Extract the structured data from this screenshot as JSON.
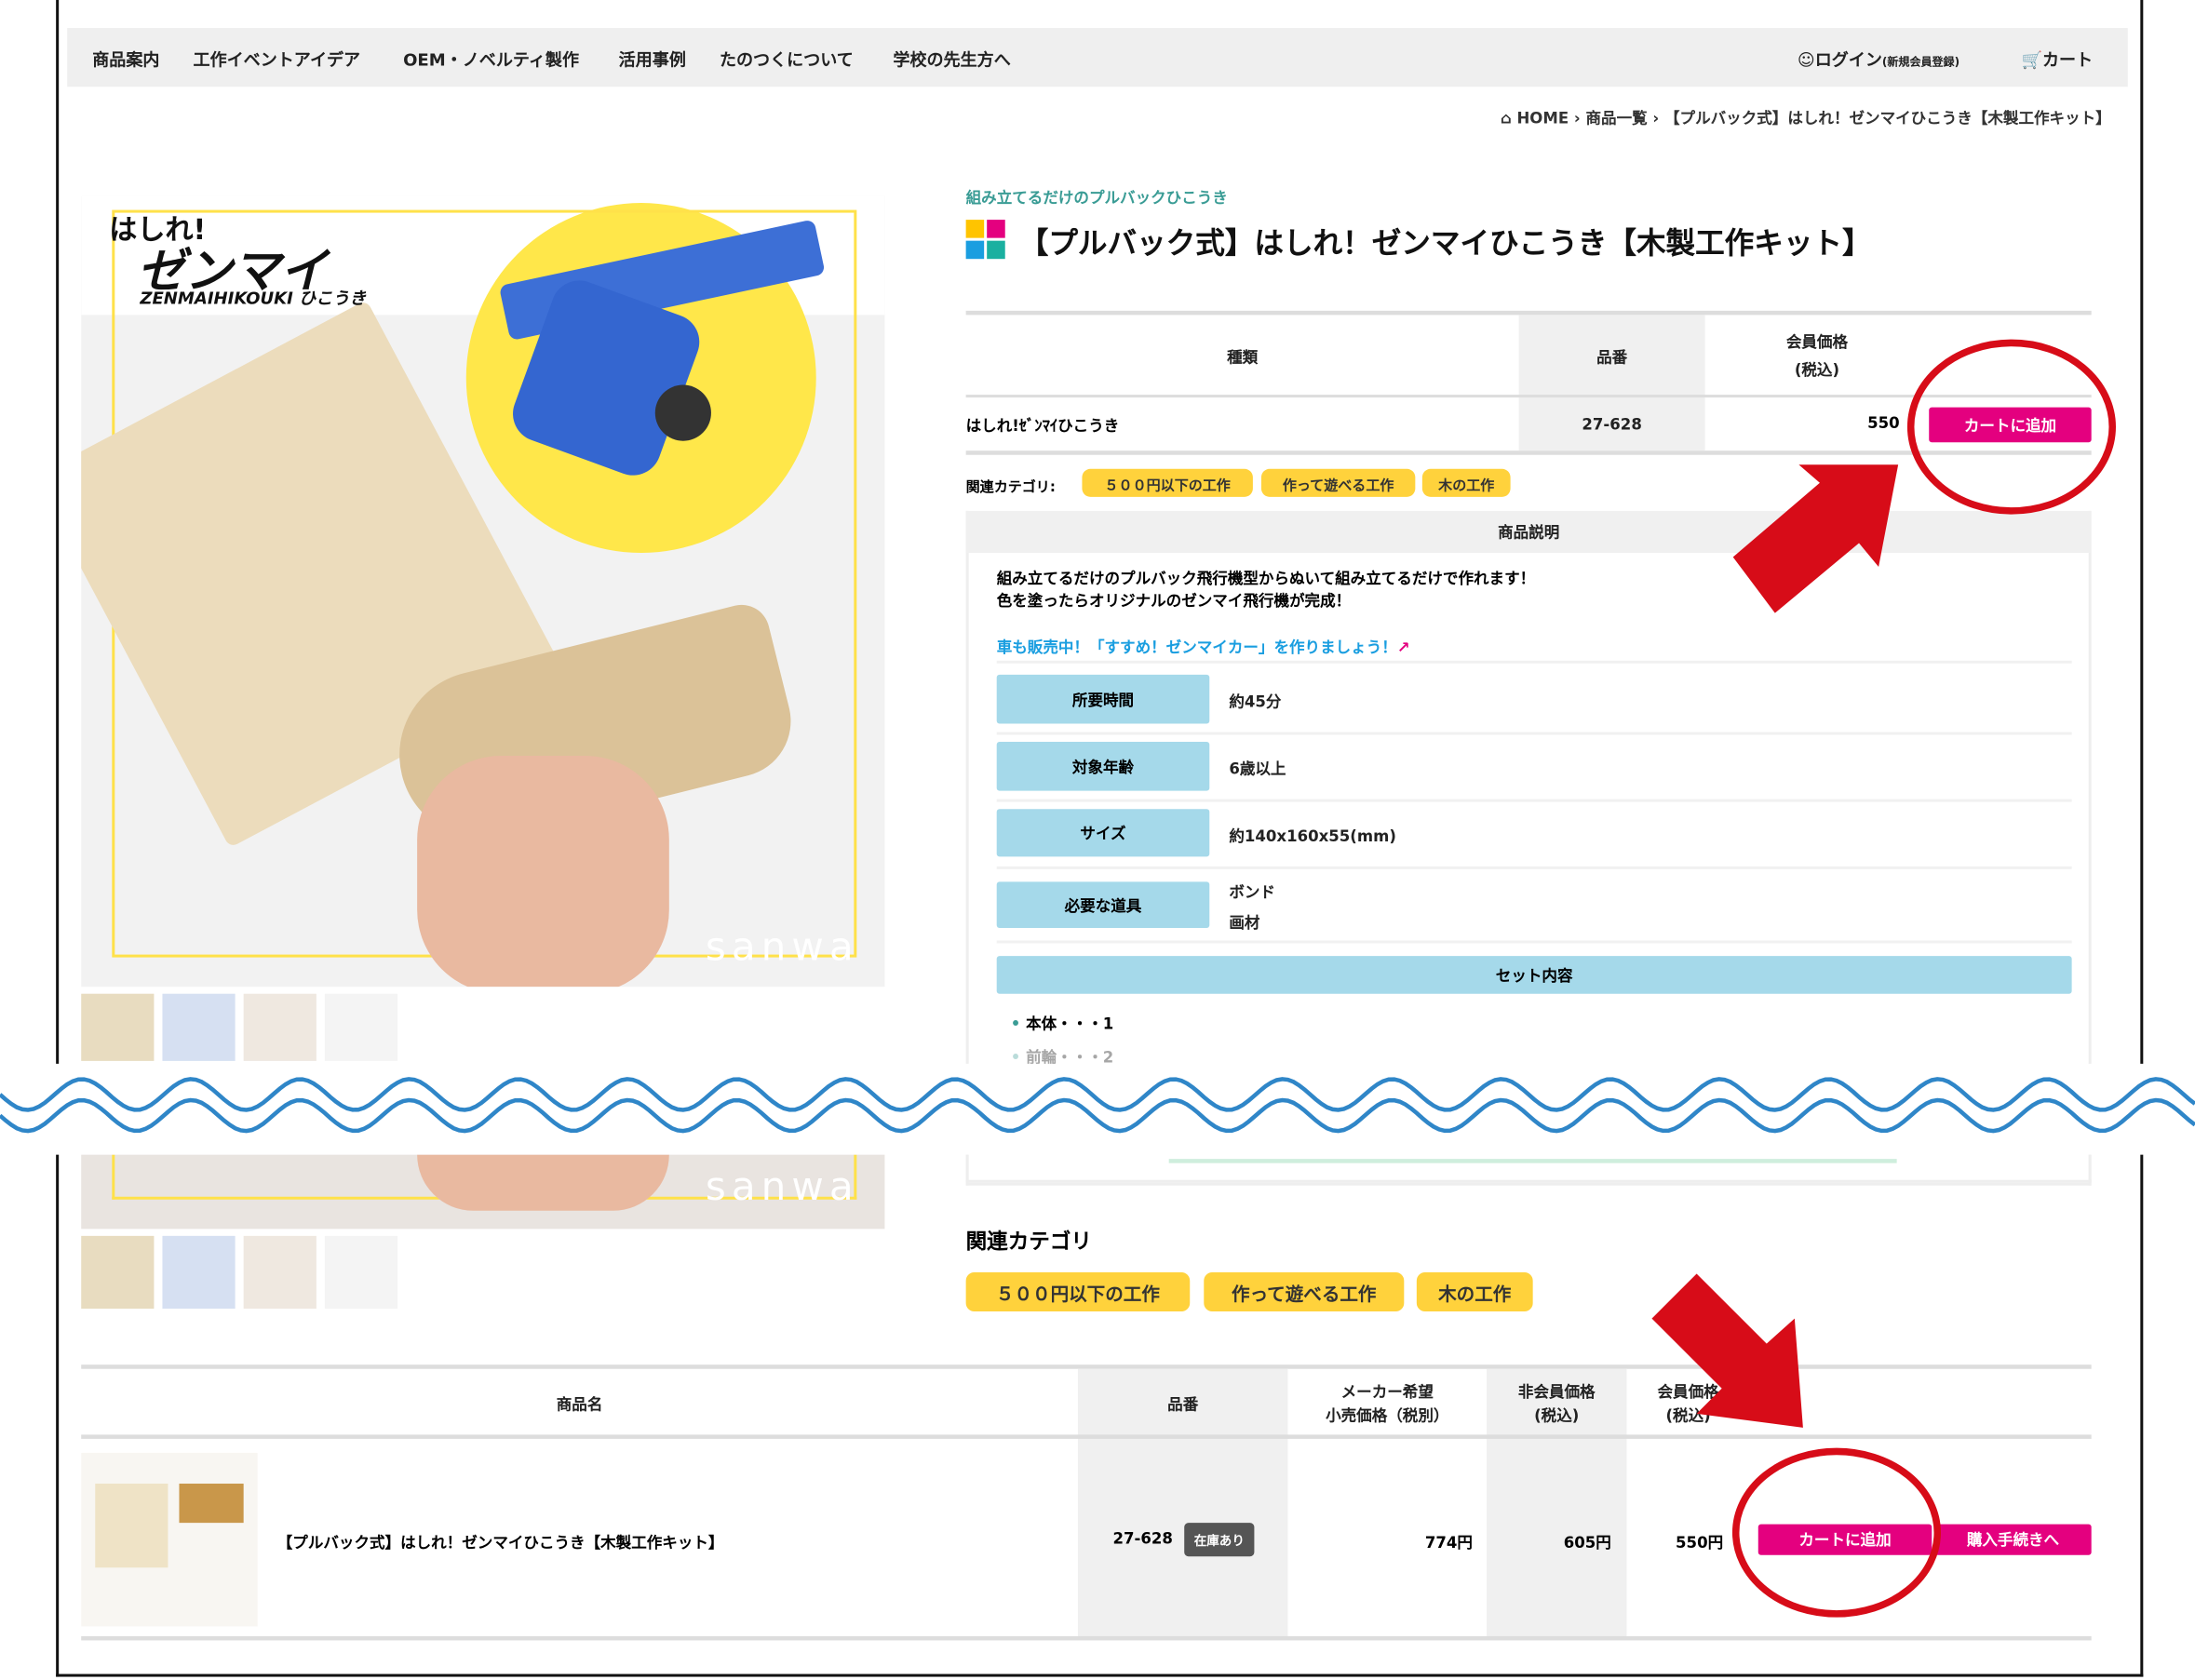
{
  "nav": {
    "items": [
      "商品案内",
      "工作イベントアイデア",
      "OEM・ノベルティ製作",
      "活用事例",
      "たのつくについて",
      "学校の先生方へ"
    ],
    "login_label": "ログイン",
    "login_note": "(新規会員登録)",
    "cart_label": "カート"
  },
  "breadcrumb": [
    "HOME",
    "商品一覧",
    "【プルバック式】はしれ！ゼンマイひこうき【木製工作キット】"
  ],
  "product_image": {
    "logo_line1": "はしれ!",
    "logo_line2": "ゼンマイ",
    "logo_line3": "ZENMAIHIKOUKI ひこうき",
    "watermark": "sanwa"
  },
  "product": {
    "subtitle": "組み立てるだけのプルバックひこうき",
    "title": "【プルバック式】はしれ！ゼンマイひこうき【木製工作キット】",
    "table": {
      "headers": [
        "種類",
        "品番",
        "会員価格\n(税込)"
      ],
      "row": {
        "name": "はしれ!ｾﾞﾝﾏｲひこうき",
        "code": "27-628",
        "price": "550",
        "button": "カートに追加"
      }
    },
    "category_label": "関連カテゴリ:",
    "categories": [
      "５００円以下の工作",
      "作って遊べる工作",
      "木の工作"
    ]
  },
  "description": {
    "header": "商品説明",
    "lines": [
      "組み立てるだけのプルバック飛行機型からぬいて組み立てるだけで作れます！",
      "色を塗ったらオリジナルのゼンマイ飛行機が完成！"
    ],
    "link": "車も販売中！「すすめ！ゼンマイカー」を作りましょう！",
    "specs": [
      {
        "label": "所要時間",
        "values": [
          "約45分"
        ]
      },
      {
        "label": "対象年齢",
        "values": [
          "6歳以上"
        ]
      },
      {
        "label": "サイズ",
        "values": [
          "約140x160x55(mm)"
        ]
      },
      {
        "label": "必要な道具",
        "values": [
          "ボンド",
          "画材"
        ]
      }
    ],
    "set_header": "セット内容",
    "set_items": [
      "本体・・・1",
      "前輪・・・2"
    ]
  },
  "related": {
    "heading": "関連カテゴリ",
    "categories": [
      "５００円以下の工作",
      "作って遊べる工作",
      "木の工作"
    ]
  },
  "list_table": {
    "headers": [
      "商品名",
      "品番",
      "メーカー希望\n小売価格（税別）",
      "非会員価格\n(税込)",
      "会員価格\n(税込)"
    ],
    "row": {
      "name": "【プルバック式】はしれ！ゼンマイひこうき【木製工作キット】",
      "code": "27-628",
      "stock": "在庫あり",
      "retail": "774円",
      "nonmember": "605円",
      "member": "550円",
      "cart_button": "カートに追加",
      "checkout_button": "購入手続きへ"
    }
  },
  "colors": {
    "accent_pink": "#e4007f",
    "tag_yellow": "#ffd23c",
    "spec_blue": "#a5d9ea",
    "annotation_red": "#d70c18",
    "wave_blue": "#2f86c8",
    "teal": "#3a9c95"
  }
}
